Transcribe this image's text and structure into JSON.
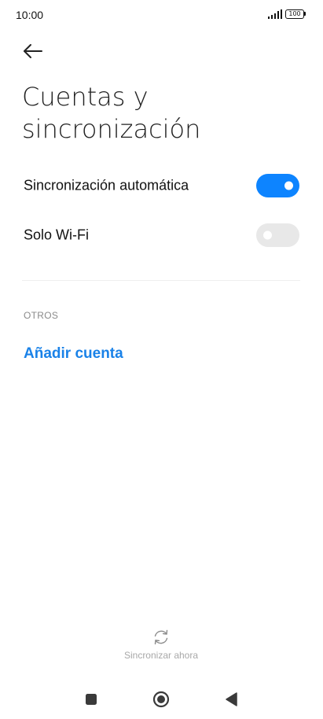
{
  "status_bar": {
    "time": "10:00",
    "battery_level": "100"
  },
  "header": {
    "back_icon": "arrow-left-icon",
    "title": "Cuentas y sincronización"
  },
  "settings": [
    {
      "label": "Sincronización automática",
      "enabled": true
    },
    {
      "label": "Solo Wi-Fi",
      "enabled": false
    }
  ],
  "others_section": {
    "header": "OTROS",
    "add_account_label": "Añadir cuenta"
  },
  "footer": {
    "sync_icon": "sync-icon",
    "sync_now_label": "Sincronizar ahora"
  },
  "nav_bar": {
    "buttons": [
      "recents-square-icon",
      "home-circle-icon",
      "back-triangle-icon"
    ]
  },
  "colors": {
    "accent": "#0d84ff",
    "link": "#1a82e8",
    "toggle_off": "#e8e8e8"
  }
}
